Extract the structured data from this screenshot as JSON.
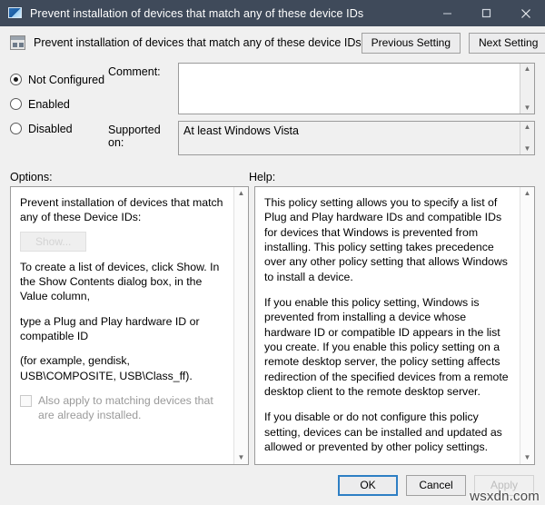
{
  "window": {
    "title": "Prevent installation of devices that match any of these device IDs",
    "icon": "policy-window-icon",
    "controls": {
      "minimize": "minimize-icon",
      "maximize": "maximize-icon",
      "close": "close-icon"
    }
  },
  "header": {
    "icon": "policy-setting-icon",
    "title": "Prevent installation of devices that match any of these device IDs",
    "previous_label": "Previous Setting",
    "next_label": "Next Setting"
  },
  "state": {
    "options": [
      {
        "label": "Not Configured",
        "selected": true
      },
      {
        "label": "Enabled",
        "selected": false
      },
      {
        "label": "Disabled",
        "selected": false
      }
    ]
  },
  "comment": {
    "label": "Comment:",
    "value": "",
    "placeholder": ""
  },
  "supported_on": {
    "label": "Supported on:",
    "value": "At least Windows Vista"
  },
  "options_panel": {
    "label": "Options:",
    "heading": "Prevent installation of devices that match any of these Device IDs:",
    "show_button": "Show...",
    "paragraph_1": "To create a list of devices, click Show. In the Show Contents dialog box, in the Value column,",
    "paragraph_2": "type a Plug and Play hardware ID or compatible ID",
    "paragraph_3": "(for example, gendisk, USB\\COMPOSITE, USB\\Class_ff).",
    "checkbox_label": "Also apply to matching devices that are already installed.",
    "checkbox_checked": false
  },
  "help_panel": {
    "label": "Help:",
    "paragraphs": [
      "This policy setting allows you to specify a list of Plug and Play hardware IDs and compatible IDs for devices that Windows is prevented from installing. This policy setting takes precedence over any other policy setting that allows Windows to install a device.",
      "If you enable this policy setting, Windows is prevented from installing a device whose hardware ID or compatible ID appears in the list you create. If you enable this policy setting on a remote desktop server, the policy setting affects redirection of the specified devices from a remote desktop client to the remote desktop server.",
      "If you disable or do not configure this policy setting, devices can be installed and updated as allowed or prevented by other policy settings."
    ]
  },
  "footer": {
    "ok_label": "OK",
    "cancel_label": "Cancel",
    "apply_label": "Apply"
  },
  "watermark": "wsxdn.com",
  "colors": {
    "titlebar": "#3f4a5a",
    "dialog_bg": "#f0f0f0",
    "focus_border": "#2e7fc4",
    "disabled_text": "#bdbdbd"
  }
}
